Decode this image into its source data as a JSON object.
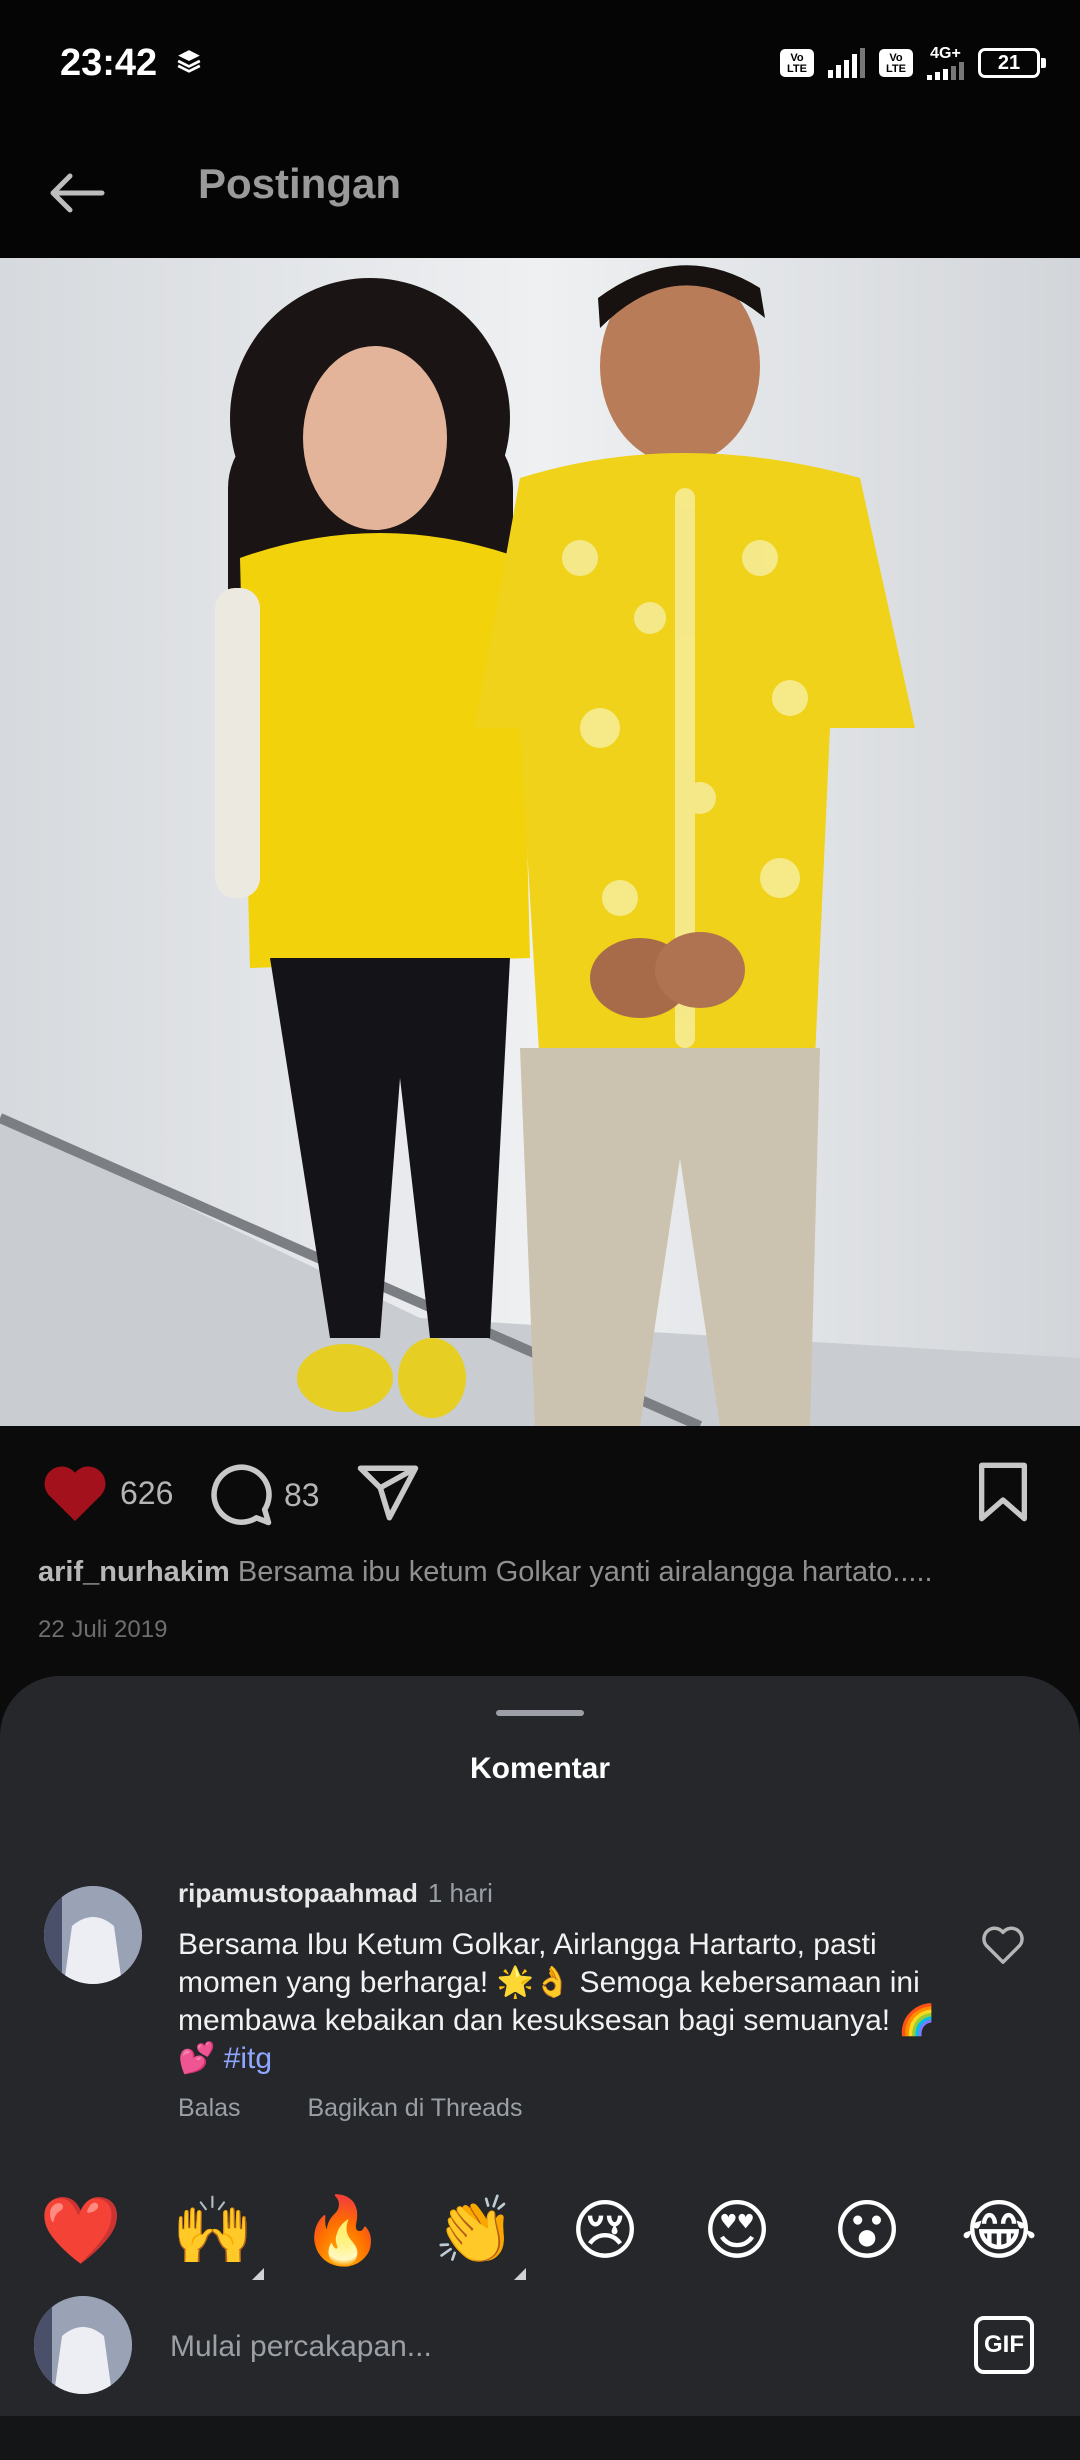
{
  "status_bar": {
    "time": "23:42",
    "volte_1": "Vo LTE",
    "volte_2": "Vo LTE",
    "network": "4G+",
    "battery": "21"
  },
  "header": {
    "title": "Postingan",
    "back_icon": "arrow-left-icon"
  },
  "post": {
    "likes": "626",
    "comments": "83",
    "username": "arif_nurhakim",
    "caption": "Bersama ibu ketum Golkar yanti airalangga hartato.....",
    "date": "22 Juli 2019"
  },
  "comments_sheet": {
    "title": "Komentar",
    "comment": {
      "username": "ripamustopaahmad",
      "time": "1 hari",
      "text": "Bersama Ibu Ketum Golkar, Airlangga Hartarto, pasti momen yang berharga! 🌟👌 Semoga kebersamaan ini membawa kebaikan dan kesuksesan bagi semuanya! 🌈💕",
      "hashtag": "#itg",
      "reply": "Balas",
      "share": "Bagikan di Threads"
    },
    "emojis": [
      "❤️",
      "🙌",
      "🔥",
      "👏",
      "😢",
      "😍",
      "😮",
      "😂"
    ],
    "input_placeholder": "Mulai percakapan...",
    "gif_label": "GIF"
  },
  "colors": {
    "like_red": "#a3121c",
    "hashtag_blue": "#8fa6ff",
    "sheet_bg": "#25272b"
  }
}
